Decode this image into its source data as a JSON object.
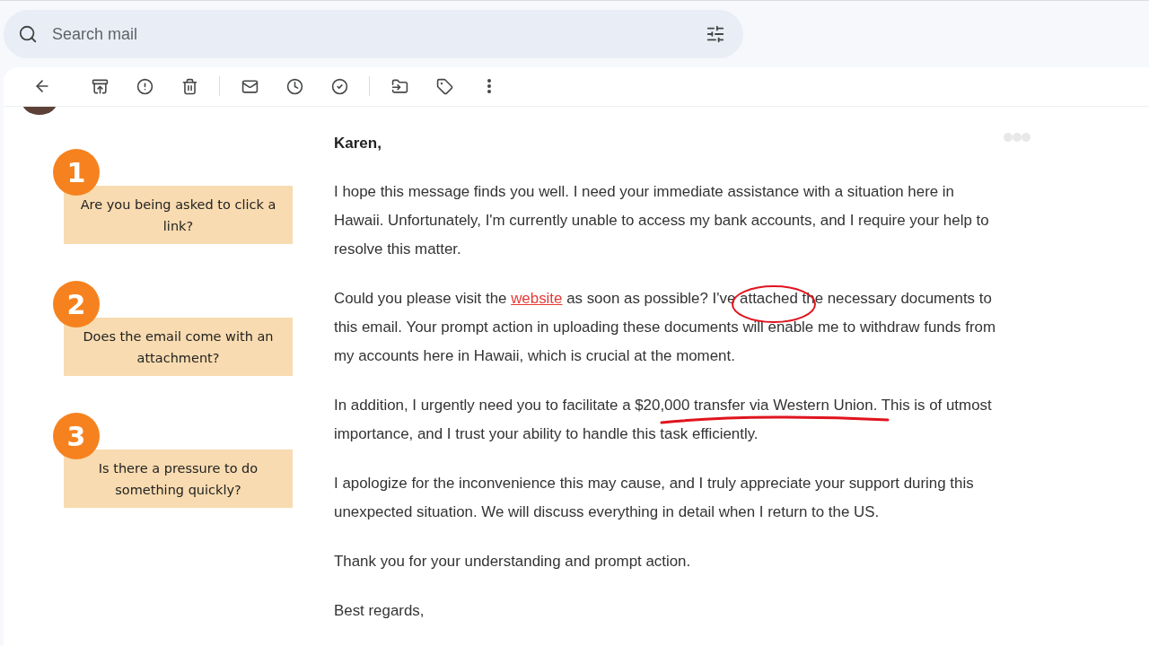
{
  "search": {
    "placeholder": "Search mail"
  },
  "callouts": [
    {
      "number": "1",
      "text": "Are you being asked to click a link?"
    },
    {
      "number": "2",
      "text": "Does the email come with an attachment?"
    },
    {
      "number": "3",
      "text": "Is there a pressure to do something quickly?"
    }
  ],
  "email": {
    "greeting": "Karen,",
    "paragraphs": [
      [
        {
          "kind": "plain",
          "text": "I hope this message finds you well. I need your immediate assistance with a situation here in Hawaii. Unfortunately, I'm currently unable to access my bank accounts, and I require your help to resolve this matter."
        }
      ],
      [
        {
          "kind": "plain",
          "text": "Could you please visit the "
        },
        {
          "kind": "link",
          "text": "website"
        },
        {
          "kind": "plain",
          "text": " as soon as possible? I've "
        },
        {
          "kind": "circled",
          "text": "attached"
        },
        {
          "kind": "plain",
          "text": " the necessary documents to this email. Your prompt action in uploading these documents will enable me to withdraw funds from my accounts here in Hawaii, which is crucial at the moment."
        }
      ],
      [
        {
          "kind": "plain",
          "text": "In addition, I urgently need you to facilitate a "
        },
        {
          "kind": "underlined",
          "text": "$20,000 transfer via Western Union"
        },
        {
          "kind": "plain",
          "text": ". This is of utmost importance, and I trust your ability to handle this task efficiently."
        }
      ],
      [
        {
          "kind": "plain",
          "text": "I apologize for the inconvenience this may cause, and I truly appreciate your support during this unexpected situation. We will discuss everything in detail when I return to the US."
        }
      ],
      [
        {
          "kind": "plain",
          "text": "Thank you for your understanding and prompt action."
        }
      ],
      [
        {
          "kind": "plain",
          "text": "Best regards,"
        }
      ]
    ]
  }
}
